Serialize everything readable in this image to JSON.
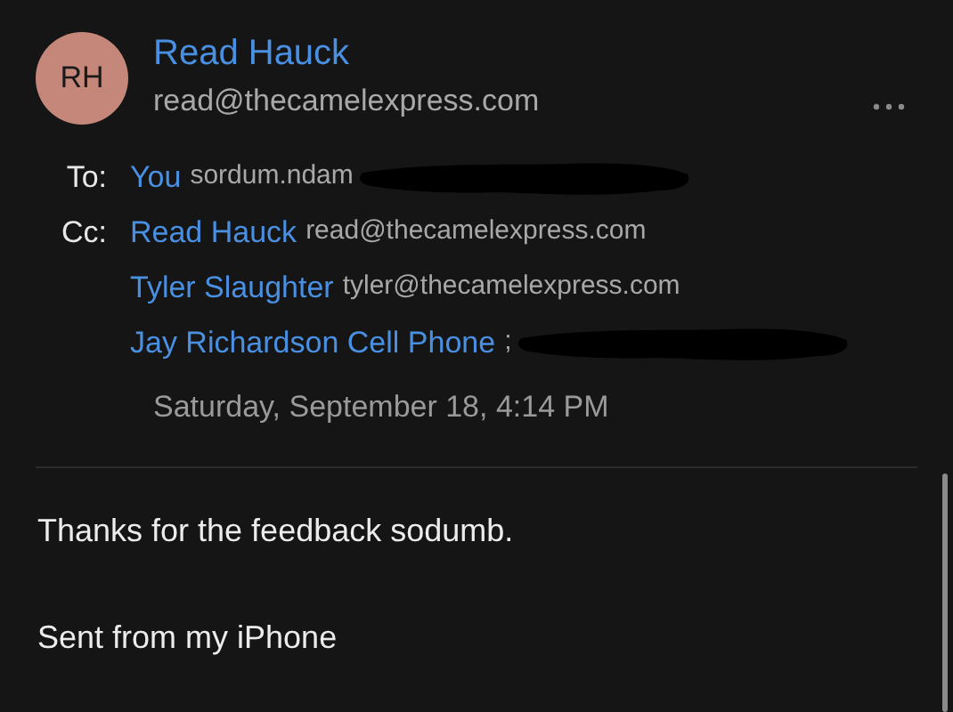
{
  "sender": {
    "initials": "RH",
    "name": "Read Hauck",
    "email": "read@thecamelexpress.com"
  },
  "recipients": [
    {
      "field_label": "To:",
      "name": "You",
      "address": "sordum.ndam",
      "redacted": true
    },
    {
      "field_label": "Cc:",
      "name": "Read Hauck",
      "address": "read@thecamelexpress.com",
      "redacted": false
    },
    {
      "name": "Tyler Slaughter",
      "address": "tyler@thecamelexpress.com",
      "redacted": false
    },
    {
      "name": "Jay Richardson Cell Phone",
      "address": ";",
      "redacted": true
    }
  ],
  "date": "Saturday, September 18, 4:14 PM",
  "body": [
    "Thanks for the feedback sodumb.",
    "Sent from my iPhone"
  ]
}
